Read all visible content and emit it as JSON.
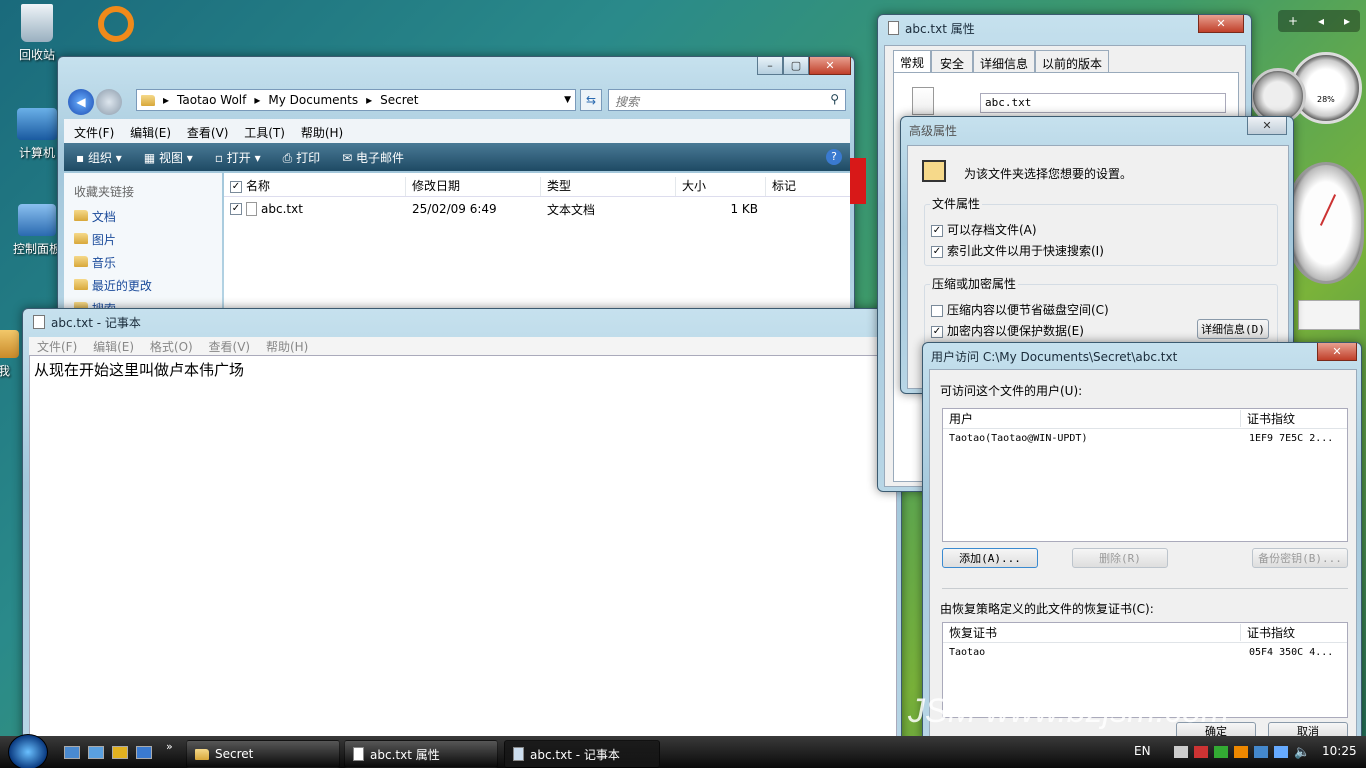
{
  "desktop": {
    "recycle_bin": "回收站",
    "computer": "计算机",
    "control_panel": "控制面板",
    "partial_label": "我"
  },
  "explorer": {
    "path": [
      "Taotao Wolf",
      "My Documents",
      "Secret"
    ],
    "search_placeholder": "搜索",
    "menu": [
      "文件(F)",
      "编辑(E)",
      "查看(V)",
      "工具(T)",
      "帮助(H)"
    ],
    "toolbar": {
      "organize": "组织",
      "views": "视图",
      "open": "打开",
      "print": "打印",
      "email": "电子邮件"
    },
    "favorites_header": "收藏夹链接",
    "favorites": [
      "文档",
      "图片",
      "音乐",
      "最近的更改",
      "搜索"
    ],
    "columns": [
      "名称",
      "修改日期",
      "类型",
      "大小",
      "标记"
    ],
    "rows": [
      {
        "name": "abc.txt",
        "date": "25/02/09 6:49",
        "type": "文本文档",
        "size": "1 KB"
      }
    ]
  },
  "notepad": {
    "title": "abc.txt - 记事本",
    "menu": [
      "文件(F)",
      "编辑(E)",
      "格式(O)",
      "查看(V)",
      "帮助(H)"
    ],
    "content": "从现在开始这里叫做卢本伟广场"
  },
  "properties": {
    "title": "abc.txt 属性",
    "tabs": [
      "常规",
      "安全",
      "详细信息",
      "以前的版本"
    ],
    "filename": "abc.txt"
  },
  "advanced": {
    "title": "高级属性",
    "intro": "为该文件夹选择您想要的设置。",
    "file_attr_header": "文件属性",
    "archive": "可以存档文件(A)",
    "index": "索引此文件以用于快速搜索(I)",
    "compress_header": "压缩或加密属性",
    "compress": "压缩内容以便节省磁盘空间(C)",
    "encrypt": "加密内容以便保护数据(E)",
    "details_btn": "详细信息(D)"
  },
  "user_access": {
    "title": "用户访问 C:\\My Documents\\Secret\\abc.txt",
    "users_label": "可访问这个文件的用户(U):",
    "users_columns": [
      "用户",
      "证书指纹"
    ],
    "users": [
      {
        "user": "Taotao(Taotao@WIN-UPDT)",
        "thumb": "1EF9 7E5C 2..."
      }
    ],
    "add_btn": "添加(A)...",
    "remove_btn": "删除(R)",
    "backup_btn": "备份密钥(B)...",
    "recovery_label": "由恢复策略定义的此文件的恢复证书(C):",
    "recovery_columns": [
      "恢复证书",
      "证书指纹"
    ],
    "recovery": [
      {
        "cert": "Taotao",
        "thumb": "05F4 350C 4..."
      }
    ],
    "ok_btn": "确定",
    "cancel_btn": "取消"
  },
  "taskbar": {
    "items": [
      "Secret",
      "abc.txt 属性",
      "abc.txt - 记事本"
    ],
    "lang": "EN",
    "clock": "10:25"
  },
  "gadgets": {
    "cpu": "28%"
  },
  "watermark": "JSM www.bzjsm.com"
}
